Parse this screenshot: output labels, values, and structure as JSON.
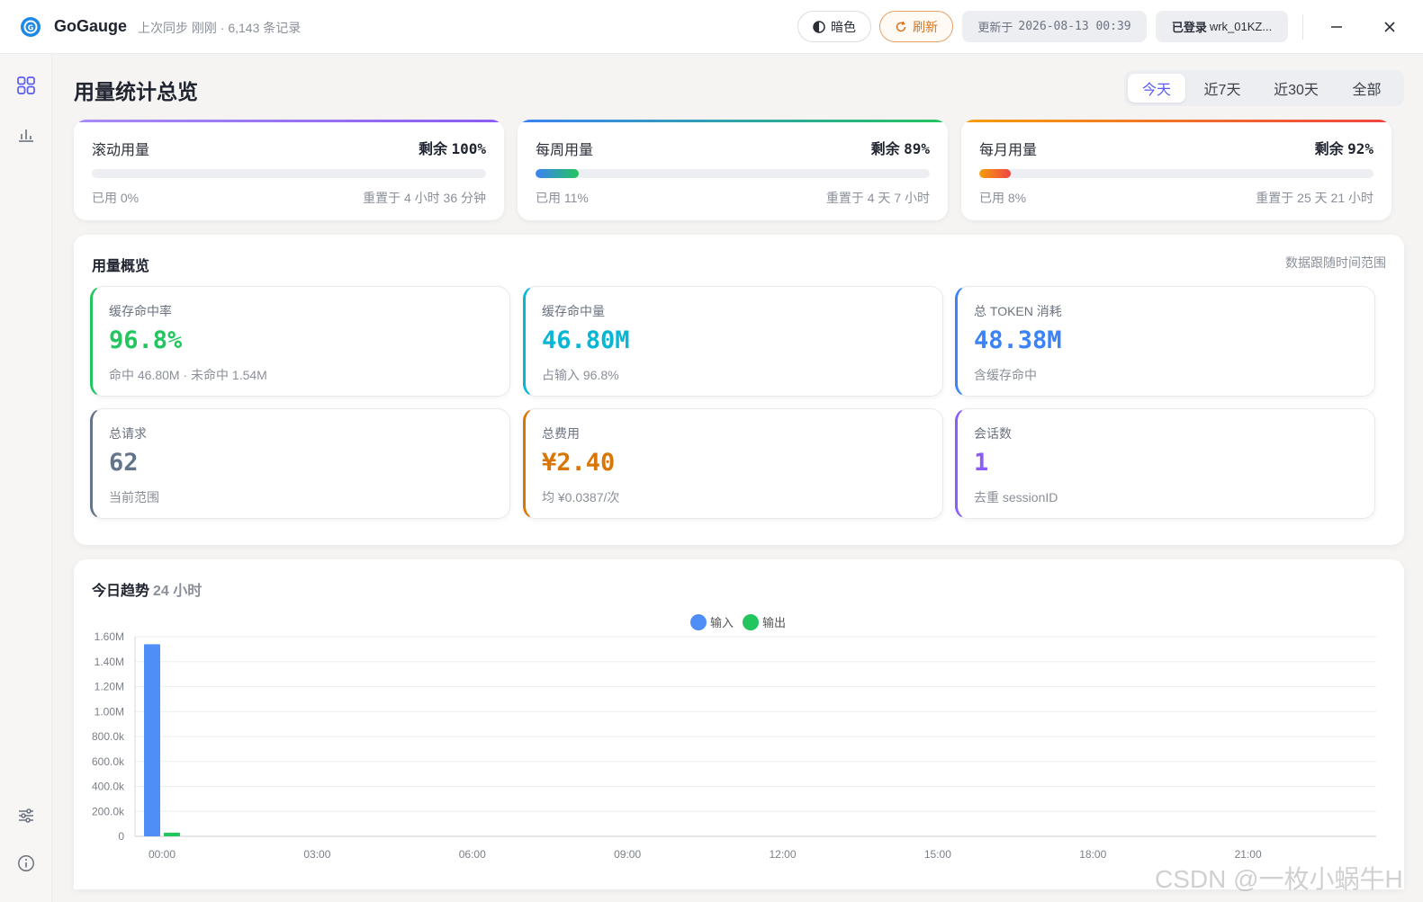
{
  "app": {
    "name": "GoGauge",
    "sync_status": "上次同步 刚刚 · 6,143 条记录"
  },
  "toolbar": {
    "theme_label": "暗色",
    "refresh_label": "刷新",
    "updated_label": "更新于",
    "updated_time": "2026-08-13 00:39",
    "login_label": "已登录",
    "user": "wrk_01KZ..."
  },
  "page": {
    "title": "用量统计总览",
    "ranges": [
      "今天",
      "近7天",
      "近30天",
      "全部"
    ],
    "active_range": "今天"
  },
  "quotas": [
    {
      "title": "滚动用量",
      "remain_label": "剩余",
      "remain": "100%",
      "used": "已用 0%",
      "used_fraction": 0.0,
      "reset": "重置于 4 小时 36 分钟",
      "accent": "#8b5cf6"
    },
    {
      "title": "每周用量",
      "remain_label": "剩余",
      "remain": "89%",
      "used": "已用 11%",
      "used_fraction": 0.11,
      "reset": "重置于 4 天 7 小时",
      "accent": "#22c55e"
    },
    {
      "title": "每月用量",
      "remain_label": "剩余",
      "remain": "92%",
      "used": "已用 8%",
      "used_fraction": 0.08,
      "reset": "重置于 25 天 21 小时",
      "accent": "#ef4444"
    }
  ],
  "overview": {
    "title": "用量概览",
    "note": "数据跟随时间范围",
    "stats": [
      {
        "label": "缓存命中率",
        "value": "96.8%",
        "sub": "命中 46.80M · 未命中 1.54M",
        "color": "#22c55e"
      },
      {
        "label": "缓存命中量",
        "value": "46.80M",
        "sub": "占输入 96.8%",
        "color": "#06b6d4"
      },
      {
        "label": "总 TOKEN 消耗",
        "value": "48.38M",
        "sub": "含缓存命中",
        "color": "#3b82f6"
      },
      {
        "label": "总请求",
        "value": "62",
        "sub": "当前范围",
        "color": "#64748b"
      },
      {
        "label": "总费用",
        "value": "¥2.40",
        "sub": "均 ¥0.0387/次",
        "color": "#d97706"
      },
      {
        "label": "会话数",
        "value": "1",
        "sub": "去重 sessionID",
        "color": "#8b5cf6"
      }
    ]
  },
  "trend": {
    "title": "今日趋势",
    "subtitle": "24 小时"
  },
  "chart_data": {
    "type": "bar",
    "x_ticks": [
      "00:00",
      "03:00",
      "06:00",
      "09:00",
      "12:00",
      "15:00",
      "18:00",
      "21:00"
    ],
    "x_hours": [
      0,
      1,
      2,
      3,
      4,
      5,
      6,
      7,
      8,
      9,
      10,
      11,
      12,
      13,
      14,
      15,
      16,
      17,
      18,
      19,
      20,
      21,
      22,
      23
    ],
    "y_ticks": [
      "0",
      "200.0k",
      "400.0k",
      "600.0k",
      "800.0k",
      "1.00M",
      "1.20M",
      "1.40M",
      "1.60M"
    ],
    "ylim": [
      0,
      1600000
    ],
    "series": [
      {
        "name": "输入",
        "color": "#4f8ef7",
        "values": [
          1540000,
          0,
          0,
          0,
          0,
          0,
          0,
          0,
          0,
          0,
          0,
          0,
          0,
          0,
          0,
          0,
          0,
          0,
          0,
          0,
          0,
          0,
          0,
          0
        ]
      },
      {
        "name": "输出",
        "color": "#22c55e",
        "values": [
          30000,
          0,
          0,
          0,
          0,
          0,
          0,
          0,
          0,
          0,
          0,
          0,
          0,
          0,
          0,
          0,
          0,
          0,
          0,
          0,
          0,
          0,
          0,
          0
        ]
      }
    ],
    "legend_position": "top-center",
    "grid": true
  },
  "watermark": "CSDN @一枚小蜗牛H"
}
